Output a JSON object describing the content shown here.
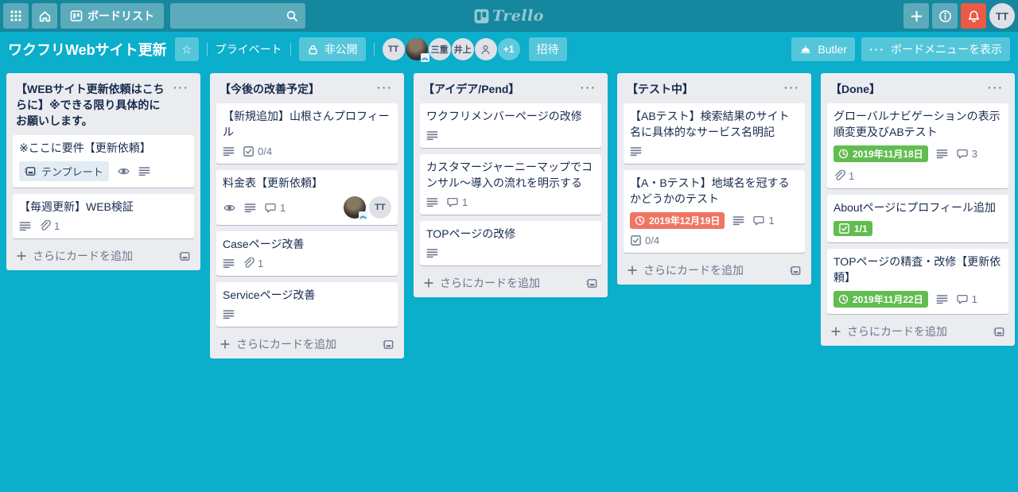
{
  "topbar": {
    "boards_button_label": "ボードリスト",
    "search_placeholder": "",
    "logo_text": "Trello",
    "user_initials": "TT"
  },
  "board_header": {
    "title": "ワクフリWebサイト更新",
    "visibility_label": "プライベート",
    "privacy_label": "非公開",
    "invite_label": "招待",
    "butler_label": "Butler",
    "board_menu_label": "ボードメニューを表示",
    "members": [
      {
        "kind": "initials",
        "label": "TT"
      },
      {
        "kind": "photo",
        "label": ""
      },
      {
        "kind": "initials",
        "label": "三重"
      },
      {
        "kind": "initials",
        "label": "井上"
      },
      {
        "kind": "person-icon",
        "label": ""
      },
      {
        "kind": "overflow",
        "label": "+1"
      }
    ]
  },
  "board": {
    "add_card_label": "さらにカードを追加",
    "lists": [
      {
        "title": "【WEBサイト更新依頼はこちらに】※できる限り具体的にお願いします。",
        "cards": [
          {
            "title": "※ここに要件【更新依頼】",
            "badge_rows": [
              [
                {
                  "type": "template",
                  "label": "テンプレート"
                },
                {
                  "type": "watch"
                },
                {
                  "type": "desc"
                }
              ]
            ]
          },
          {
            "title": "【毎週更新】WEB検証",
            "badge_rows": [
              [
                {
                  "type": "desc"
                },
                {
                  "type": "attach",
                  "count": "1"
                }
              ]
            ]
          }
        ]
      },
      {
        "title": "【今後の改善予定】",
        "cards": [
          {
            "title": "【新規追加】山根さんプロフィール",
            "badge_rows": [
              [
                {
                  "type": "desc"
                },
                {
                  "type": "checklist",
                  "count": "0/4"
                }
              ]
            ]
          },
          {
            "title": "料金表【更新依頼】",
            "badge_rows": [
              [
                {
                  "type": "watch"
                },
                {
                  "type": "desc"
                },
                {
                  "type": "comment",
                  "count": "1"
                }
              ]
            ],
            "members": [
              {
                "kind": "photo",
                "label": ""
              },
              {
                "kind": "initials",
                "label": "TT"
              }
            ]
          },
          {
            "title": "Caseページ改善",
            "badge_rows": [
              [
                {
                  "type": "desc"
                },
                {
                  "type": "attach",
                  "count": "1"
                }
              ]
            ]
          },
          {
            "title": "Serviceページ改善",
            "badge_rows": [
              [
                {
                  "type": "desc"
                }
              ]
            ]
          }
        ]
      },
      {
        "title": "【アイデア/Pend】",
        "cards": [
          {
            "title": "ワクフリメンバーページの改修",
            "badge_rows": [
              [
                {
                  "type": "desc"
                }
              ]
            ]
          },
          {
            "title": "カスタマージャーニーマップでコンサル〜導入の流れを明示する",
            "badge_rows": [
              [
                {
                  "type": "desc"
                },
                {
                  "type": "comment",
                  "count": "1"
                }
              ]
            ]
          },
          {
            "title": "TOPページの改修",
            "badge_rows": [
              [
                {
                  "type": "desc"
                }
              ]
            ]
          }
        ]
      },
      {
        "title": "【テスト中】",
        "cards": [
          {
            "title": "【ABテスト】検索結果のサイト名に具体的なサービス名明記",
            "badge_rows": [
              [
                {
                  "type": "desc"
                }
              ]
            ]
          },
          {
            "title": "【A・Bテスト】地域名を冠するかどうかのテスト",
            "badge_rows": [
              [
                {
                  "type": "due",
                  "label": "2019年12月19日",
                  "color": "#ef7564"
                },
                {
                  "type": "desc"
                },
                {
                  "type": "comment",
                  "count": "1"
                }
              ],
              [
                {
                  "type": "checklist",
                  "count": "0/4"
                }
              ]
            ]
          }
        ]
      },
      {
        "title": "【Done】",
        "cards": [
          {
            "title": "グローバルナビゲーションの表示順変更及びABテスト",
            "badge_rows": [
              [
                {
                  "type": "due",
                  "label": "2019年11月18日",
                  "color": "#61bd4f"
                },
                {
                  "type": "desc"
                },
                {
                  "type": "comment",
                  "count": "3"
                },
                {
                  "type": "attach",
                  "count": "1"
                }
              ]
            ]
          },
          {
            "title": "Aboutページにプロフィール追加",
            "badge_rows": [
              [
                {
                  "type": "checklist",
                  "count": "1/1",
                  "color": "#61bd4f"
                }
              ]
            ]
          },
          {
            "title": "TOPページの精査・改修【更新依頼】",
            "badge_rows": [
              [
                {
                  "type": "due",
                  "label": "2019年11月22日",
                  "color": "#61bd4f"
                },
                {
                  "type": "desc"
                },
                {
                  "type": "comment",
                  "count": "1"
                }
              ]
            ]
          }
        ]
      }
    ]
  },
  "colors": {
    "board_background": "#0baecb",
    "topbar_background": "#15879e",
    "due_soon_red": "#ef7564",
    "done_green": "#61bd4f",
    "notification_red": "#eb5a46",
    "list_background": "#ebecf0",
    "card_text": "#172b4d"
  }
}
